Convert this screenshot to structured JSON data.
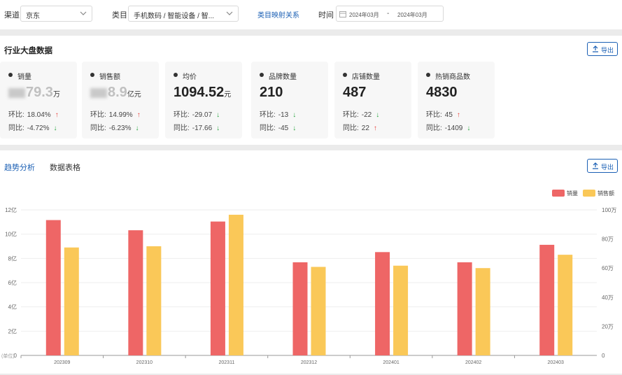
{
  "filters": {
    "channel_label": "渠道",
    "channel_value": "京东",
    "category_label": "类目",
    "category_value": "手机数码 / 智能设备 / 智...",
    "mapping_link": "类目映射关系",
    "time_label": "时间",
    "date_start": "2024年03月",
    "date_sep": "-",
    "date_end": "2024年03月"
  },
  "overview": {
    "title": "行业大盘数据",
    "export_label": "导出",
    "cards": [
      {
        "label": "销量",
        "value_visible": "79.3",
        "unit": "万",
        "mom_label": "环比:",
        "mom": "18.04%",
        "mom_dir": "up",
        "yoy_label": "同比:",
        "yoy": "-4.72%",
        "yoy_dir": "down",
        "blurred": true
      },
      {
        "label": "销售额",
        "value_visible": "8.9",
        "unit": "亿元",
        "mom_label": "环比:",
        "mom": "14.99%",
        "mom_dir": "up",
        "yoy_label": "同比:",
        "yoy": "-6.23%",
        "yoy_dir": "down",
        "blurred": true
      },
      {
        "label": "均价",
        "value_visible": "1094.52",
        "unit": "元",
        "mom_label": "环比:",
        "mom": "-29.07",
        "mom_dir": "down",
        "yoy_label": "同比:",
        "yoy": "-17.66",
        "yoy_dir": "down",
        "blurred": false
      },
      {
        "label": "品牌数量",
        "value_visible": "210",
        "unit": "",
        "mom_label": "环比:",
        "mom": "-13",
        "mom_dir": "down",
        "yoy_label": "同比:",
        "yoy": "-45",
        "yoy_dir": "down",
        "blurred": false
      },
      {
        "label": "店铺数量",
        "value_visible": "487",
        "unit": "",
        "mom_label": "环比:",
        "mom": "-22",
        "mom_dir": "down",
        "yoy_label": "同比:",
        "yoy": "22",
        "yoy_dir": "up",
        "blurred": false
      },
      {
        "label": "热销商品数",
        "value_visible": "4830",
        "unit": "",
        "mom_label": "环比:",
        "mom": "45",
        "mom_dir": "up",
        "yoy_label": "同比:",
        "yoy": "-1409",
        "yoy_dir": "down",
        "blurred": false
      }
    ]
  },
  "trend": {
    "tabs": [
      "趋势分析",
      "数据表格"
    ],
    "active_tab": 0,
    "export_label": "导出"
  },
  "colors": {
    "accent": "#1a5fb4",
    "series_sales_volume": "#ee6666",
    "series_sales_amount": "#fac858",
    "up": "#e8403a",
    "down": "#22a33a"
  },
  "chart_data": {
    "type": "bar",
    "categories": [
      "202309",
      "202310",
      "202311",
      "202312",
      "202401",
      "202402",
      "202403"
    ],
    "series": [
      {
        "name": "销量",
        "axis": "right",
        "values": [
          93,
          86,
          92,
          64,
          71,
          64,
          76
        ]
      },
      {
        "name": "销售额",
        "axis": "left",
        "values": [
          8.9,
          9.0,
          11.6,
          7.3,
          7.4,
          7.2,
          8.3
        ]
      }
    ],
    "left_axis": {
      "ticks": [
        "0",
        "2亿",
        "4亿",
        "6亿",
        "8亿",
        "10亿",
        "12亿"
      ],
      "ylim": [
        0,
        12
      ],
      "unit_label": "(单位)"
    },
    "right_axis": {
      "ticks": [
        "0",
        "20万",
        "40万",
        "60万",
        "80万",
        "100万"
      ],
      "ylim": [
        0,
        100
      ]
    },
    "legend": "top-right",
    "grid": true
  }
}
